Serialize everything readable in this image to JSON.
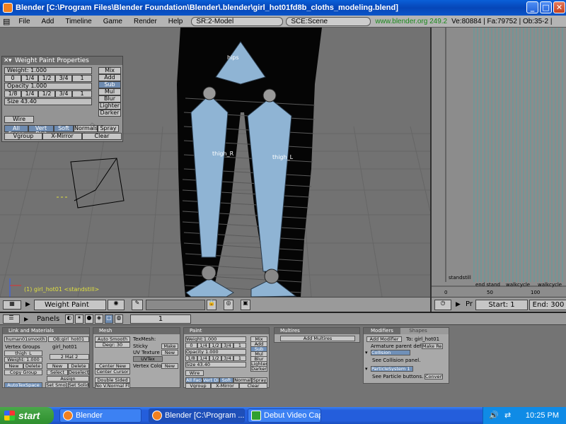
{
  "window": {
    "title": "Blender [C:\\Program Files\\Blender Foundation\\Blender\\.blender\\girl_hot01fd8b_cloths_modeling.blend]",
    "minimize": "_",
    "maximize": "□",
    "close": "✕"
  },
  "menubar": {
    "items": [
      "File",
      "Add",
      "Timeline",
      "Game",
      "Render",
      "Help"
    ],
    "screen": "SR:2-Model",
    "scene": "SCE:Scene",
    "url": "www.blender.org 249.2",
    "stats": "Ve:80884 | Fa:79752 | Ob:35-2 |"
  },
  "weight_panel": {
    "title": "Weight Paint Properties",
    "weight_label": "Weight: 1.000",
    "weight_presets": [
      "0",
      "1/4",
      "1/2",
      "3/4",
      "1"
    ],
    "opacity_label": "Opacity 1.000",
    "opacity_presets": [
      "1/8",
      "1/4",
      "1/2",
      "3/4",
      "1"
    ],
    "size_label": "Size 43.40",
    "modes": [
      "Mix",
      "Add",
      "Sub",
      "Mul",
      "Blur",
      "Lighter",
      "Darker"
    ],
    "selected_mode": "Sub",
    "wire": "Wire",
    "options": [
      "All Faces",
      "Vert Dist",
      "Soft",
      "Normals",
      "Spray"
    ],
    "row3": [
      "Vgroup",
      "X-Mirror",
      "Clear"
    ]
  },
  "viewport": {
    "bone_labels": [
      "hips",
      "thigh_R",
      "thigh_L"
    ],
    "status": "(1) girl_hot01  <standstill>"
  },
  "viewport_header": {
    "mode": "Weight Paint"
  },
  "timeline": {
    "markers": [
      "standstill",
      "end stand",
      "walkcycle",
      "walkcycle"
    ],
    "ticks": [
      "0",
      "50",
      "100"
    ],
    "pr_label": "Pr",
    "start": "Start: 1",
    "end": "End: 300"
  },
  "buttons_header": {
    "panels_label": "Panels",
    "frame": "1"
  },
  "link_panel": {
    "title": "Link and Materials",
    "mesh_name": "human01smooth",
    "ob_name": "OB:girl_hot01",
    "vertex_groups_label": "Vertex Groups",
    "object_name": "girl_hot01",
    "vgroup": "thigh_L",
    "mat": "2 Mat 2",
    "weight": "Weight: 1.000",
    "buttons": [
      "New",
      "Delete",
      "New",
      "Delete",
      "Copy Group",
      "Select",
      "Deselect",
      "Assign"
    ],
    "autotex": "AutoTexSpace",
    "set_smooth": "Set Smo",
    "set_solid": "Set Solid"
  },
  "mesh_panel": {
    "title": "Mesh",
    "auto_smooth": "Auto Smooth",
    "degr": "Degr: 30",
    "texmesh": "TexMesh:",
    "sticky": "Sticky",
    "make": "Make",
    "uv_texture": "UV Texture",
    "new": "New",
    "uvtex": "UVTex",
    "vertex_color": "Vertex Color",
    "new2": "New",
    "center_new": "Center New",
    "center_cursor": "Center Cursor",
    "double_sided": "Double Sided",
    "no_vnormal": "No V.Normal Flip"
  },
  "paint_panel": {
    "title": "Paint",
    "weight": "Weight:1.000",
    "presets": [
      "0",
      "1/4",
      "1/2",
      "3/4",
      "1"
    ],
    "opacity": "Opacity 1.000",
    "presets2": [
      "1/8",
      "1/4",
      "1/2",
      "3/4",
      "1"
    ],
    "size": "Size 43.40",
    "modes": [
      "Mix",
      "Add",
      "Sub",
      "Mul",
      "Blur",
      "Lighter",
      "Darker"
    ],
    "wire": "Wire",
    "options": [
      "All Faces",
      "Vert Dist",
      "Soft",
      "Normal",
      "Spray"
    ],
    "row3": [
      "Vgroup",
      "X-Mirror",
      "Clear"
    ]
  },
  "multires_panel": {
    "title": "Multires",
    "add_button": "Add Multires"
  },
  "modifiers_panel": {
    "tabs": [
      "Modifiers",
      "Shapes"
    ],
    "add_modifier": "Add Modifier",
    "to": "To: girl_hot01",
    "armature_note": "Armature parent deform",
    "make_real": "Make Real",
    "collision": "Collision",
    "collision_note": "See Collision panel.",
    "particle": "ParticleSystem 1",
    "particle_note": "See Particle buttons.",
    "convert": "Convert"
  },
  "taskbar": {
    "start": "start",
    "tasks": [
      "Blender",
      "Blender [C:\\Program ...",
      "Debut Video Capture ..."
    ],
    "clock": "10:25 PM"
  }
}
